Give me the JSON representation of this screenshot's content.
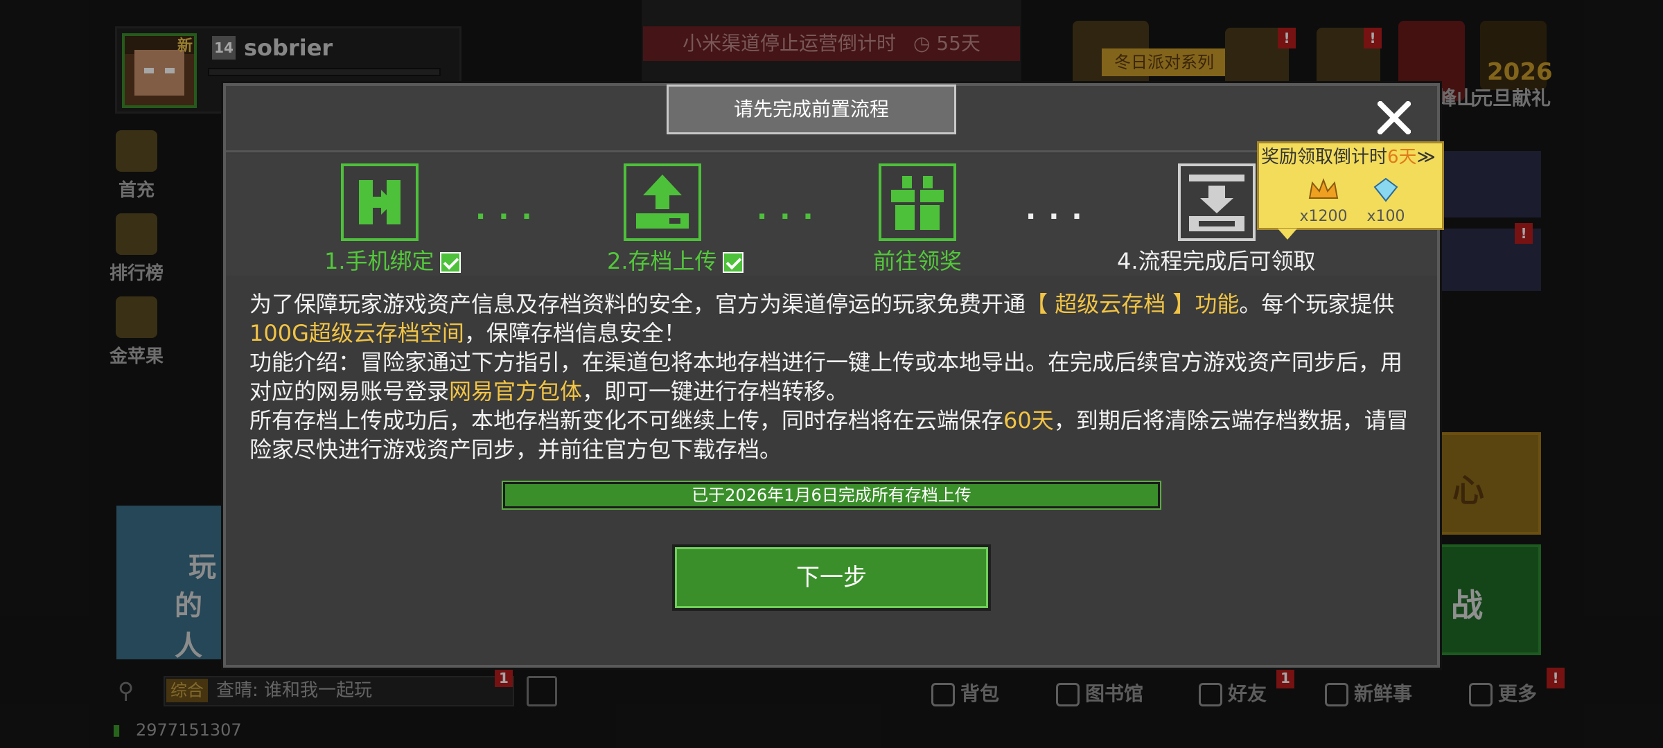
{
  "profile": {
    "new_tag": "新",
    "level": "14",
    "username": "sobrier"
  },
  "notice": {
    "text": "小米渠道停止运营倒计时",
    "countdown": "55天"
  },
  "top_events": {
    "winter_party": "冬日派对系列",
    "label_2026": "2026",
    "label_newyear": "元旦献礼",
    "label_shan": "峰山"
  },
  "left_menu": [
    {
      "label": "首充"
    },
    {
      "label": "排行榜"
    },
    {
      "label": "金苹果"
    }
  ],
  "banner": {
    "line1": "玩",
    "line2": "的人"
  },
  "right_boxes": {
    "yellow_text": "心",
    "green_text": "战"
  },
  "chat": {
    "tag": "综合",
    "message": "查晴: 谁和我一起玩",
    "badge": "1"
  },
  "bottom_nav": [
    {
      "label": "背包"
    },
    {
      "label": "图书馆"
    },
    {
      "label": "好友",
      "badge": "1"
    },
    {
      "label": "新鲜事"
    },
    {
      "label": "更多",
      "badge": "!"
    }
  ],
  "uid": "2977151307",
  "modal": {
    "title": "请先完成前置流程",
    "steps": [
      {
        "label": "1.手机绑定",
        "done": true
      },
      {
        "label": "2.存档上传",
        "done": true
      },
      {
        "label": "前往领奖",
        "done": false
      },
      {
        "label": "4.流程完成后可领取",
        "done": false
      }
    ],
    "dots": "...",
    "paragraph1_a": "为了保障玩家游戏资产信息及存档资料的安全，官方为渠道停运的玩家免费开通",
    "paragraph1_hl": "【 超级云存档 】功能",
    "paragraph1_b": "。每个玩家提供",
    "paragraph1_hl2": "100G超级云存档空间",
    "paragraph1_c": "，保障存档信息安全！",
    "paragraph2_a": "功能介绍：冒险家通过下方指引，在渠道包将本地存档进行一键上传或本地导出。在完成后续官方游戏资产同步后，用对应的网易账号登录",
    "paragraph2_hl": "网易官方包体",
    "paragraph2_b": "，即可一键进行存档转移。",
    "paragraph3_a": "所有存档上传成功后，本地存档新变化不可继续上传，同时存档将在云端保存",
    "paragraph3_hl": "60天",
    "paragraph3_b": "，到期后将清除云端存档数据，请冒险家尽快进行游戏资产同步，并前往官方包下载存档。",
    "progress_text": "已于2026年1月6日完成所有存档上传",
    "next_button": "下一步"
  },
  "reward": {
    "title_a": "奖励领取倒计时",
    "title_hl": "6天",
    "arrow": "≫",
    "items": [
      {
        "qty": "x1200",
        "icon": "crown-icon"
      },
      {
        "qty": "x100",
        "icon": "diamond-icon"
      }
    ]
  },
  "colors": {
    "accent_green": "#4dc13a",
    "highlight": "#f2c445",
    "modal_bg": "#3b3b3b",
    "reward_bg": "#f2dc5a"
  }
}
